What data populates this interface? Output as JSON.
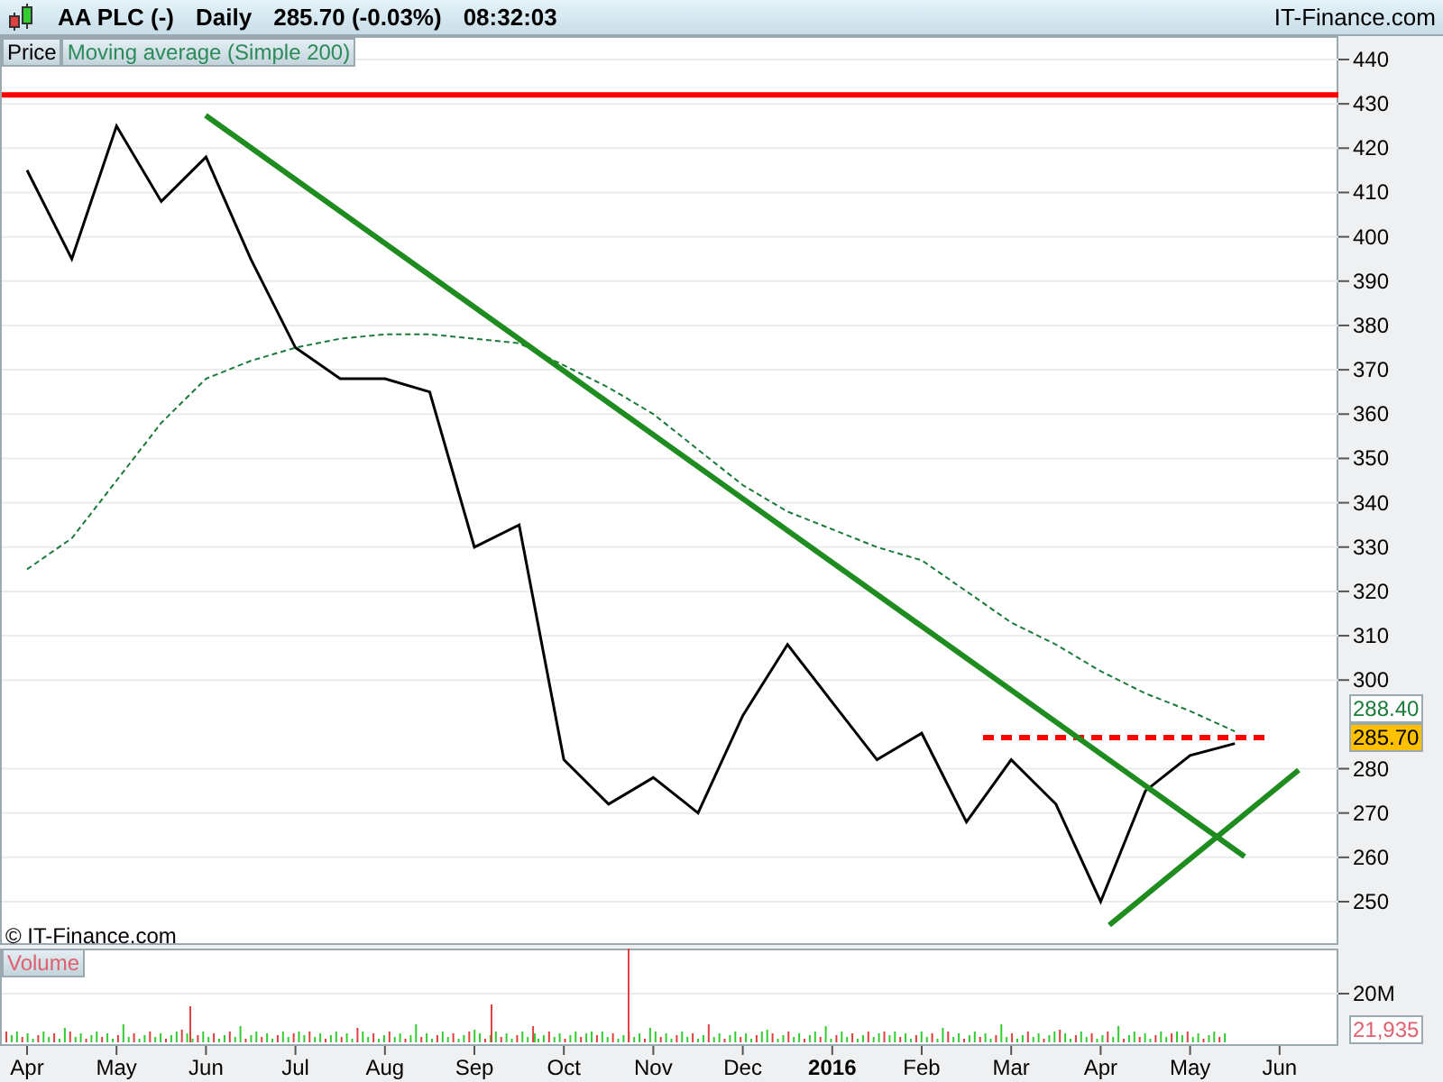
{
  "header": {
    "instrument": "AA PLC (-)",
    "period": "Daily",
    "quote": "285.70 (-0.03%)",
    "time": "08:32:03",
    "brand": "IT-Finance.com"
  },
  "copyright": "© IT-Finance.com",
  "price_chart": {
    "chart_data": {
      "type": "line",
      "categories": [
        "Apr",
        null,
        "May",
        null,
        "Jun",
        null,
        "Jul",
        null,
        "Aug",
        null,
        "Sep",
        null,
        "Oct",
        null,
        "Nov",
        null,
        "Dec",
        null,
        "2016",
        null,
        "Feb",
        null,
        "Mar",
        null,
        "Apr",
        null,
        "May",
        null,
        "Jun"
      ],
      "series": [
        {
          "name": "Price",
          "color": "#000000",
          "line_style": "solid",
          "values": [
            415,
            395,
            425,
            408,
            418,
            395,
            375,
            368,
            368,
            365,
            330,
            335,
            282,
            272,
            278,
            270,
            292,
            308,
            295,
            282,
            288,
            268,
            282,
            272,
            250,
            275,
            283,
            285.7,
            null
          ]
        },
        {
          "name": "Moving average (Simple 200)",
          "color": "#1a7a3a",
          "line_style": "dashed",
          "values": [
            325,
            332,
            345,
            358,
            368,
            372,
            375,
            377,
            378,
            378,
            377,
            376,
            371,
            366,
            360,
            352,
            344,
            338,
            334,
            330,
            327,
            320,
            313,
            308,
            302,
            297,
            293,
            288.4,
            null
          ]
        }
      ],
      "ylim": [
        250,
        440
      ],
      "grid": true,
      "ref_lines": [
        {
          "axis": "y",
          "value": 432,
          "color": "#ff0000",
          "line_style": "solid"
        }
      ],
      "yticks": [
        250,
        260,
        270,
        280,
        300,
        310,
        320,
        330,
        340,
        350,
        360,
        370,
        380,
        390,
        400,
        410,
        420,
        430,
        440
      ]
    },
    "value_labels": [
      {
        "text": "288.40",
        "kind": "average"
      },
      {
        "text": "285.70",
        "kind": "last"
      }
    ]
  },
  "volume": {
    "label": "Volume",
    "tick": "20M",
    "reading": "21,935"
  }
}
